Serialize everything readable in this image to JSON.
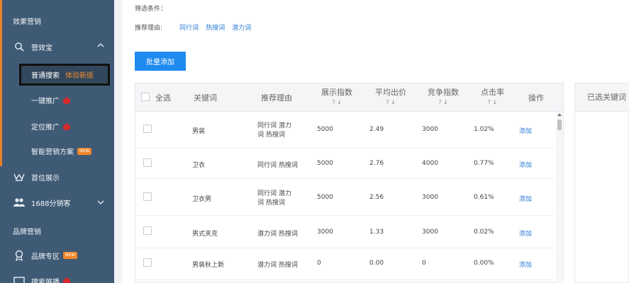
{
  "sidebar": {
    "section_effect": "效果营销",
    "yingxiaobao": "营效宝",
    "active_item": {
      "label": "普通搜索",
      "tag": "体验新版"
    },
    "sub_items": [
      "一键推广",
      "定位推广",
      "智能营销方案"
    ],
    "new_badge": "NEW",
    "top_show": "首位展示",
    "sale_guest": "1688分销客",
    "section_brand": "品牌营销",
    "brand_zone": "品牌专区",
    "search_partial": "搜索展播"
  },
  "filters": {
    "label": "筛选条件：",
    "reason_label": "推荐理由:",
    "reasons": [
      "同行词",
      "热搜词",
      "潜力词"
    ]
  },
  "batch_button": "批量添加",
  "table": {
    "headers": {
      "select_all": "全选",
      "keyword": "关键词",
      "reason": "推荐理由",
      "display": "展示指数",
      "avg_bid": "平均出价",
      "competition": "竞争指数",
      "ctr": "点击率",
      "action": "操作"
    },
    "sort_hint": "? ↓",
    "rows": [
      {
        "keyword": "男装",
        "reason_line1": "同行词 潜力",
        "reason_line2": "词 热搜词",
        "display": "5000",
        "bid": "2.49",
        "competition": "3000",
        "ctr": "1.02%",
        "action": "添加"
      },
      {
        "keyword": "卫衣",
        "reason_line1": "同行词 热搜词",
        "reason_line2": "",
        "display": "5000",
        "bid": "2.76",
        "competition": "4000",
        "ctr": "0.77%",
        "action": "添加"
      },
      {
        "keyword": "卫衣男",
        "reason_line1": "同行词 潜力",
        "reason_line2": "词 热搜词",
        "display": "5000",
        "bid": "2.56",
        "competition": "3000",
        "ctr": "0.61%",
        "action": "添加"
      },
      {
        "keyword": "男式夹克",
        "reason_line1": "潜力词 热搜词",
        "reason_line2": "",
        "display": "3000",
        "bid": "1.33",
        "competition": "3000",
        "ctr": "0.02%",
        "action": "添加"
      },
      {
        "keyword": "男装秋上新",
        "reason_line1": "潜力词 热搜词",
        "reason_line2": "",
        "display": "0",
        "bid": "0.00",
        "competition": "0",
        "ctr": "0.00%",
        "action": "添加"
      }
    ]
  },
  "selected_panel_title": "已选关键词",
  "colors": {
    "sidebar": "#3f5a75",
    "accent": "#e5812a",
    "primary": "#1f8af0",
    "link": "#2b7bd6",
    "hot": "#d42a2a"
  }
}
